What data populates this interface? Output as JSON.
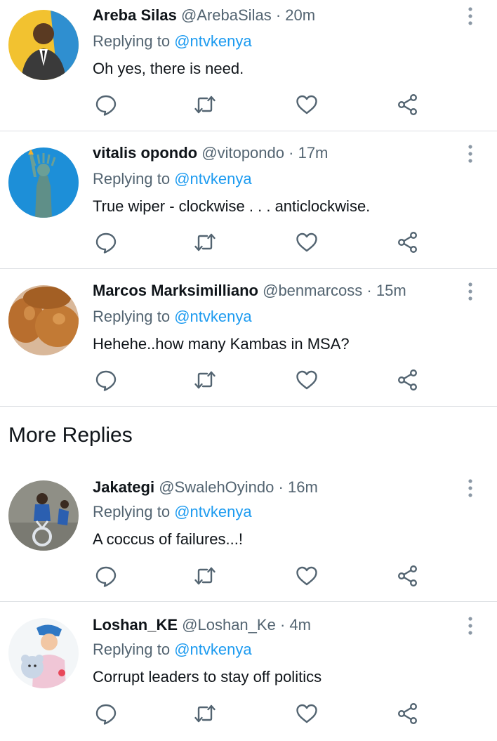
{
  "section": {
    "more_replies_label": "More Replies"
  },
  "tweets": [
    {
      "name": "Areba Silas",
      "handle": "@ArebaSilas",
      "separator": "·",
      "time": "20m",
      "replying_prefix": "Replying to",
      "replying_to": "@ntvkenya",
      "text": "Oh yes, there is need."
    },
    {
      "name": "vitalis opondo",
      "handle": "@vitopondo",
      "separator": "·",
      "time": "17m",
      "replying_prefix": "Replying to",
      "replying_to": "@ntvkenya",
      "text": "True wiper - clockwise . . . anticlockwise."
    },
    {
      "name": "Marcos Marksimilliano",
      "handle": "@benmarcoss",
      "separator": "·",
      "time": "15m",
      "replying_prefix": "Replying to",
      "replying_to": "@ntvkenya",
      "text": "Hehehe..how many Kambas in MSA?"
    },
    {
      "name": "Jakategi",
      "handle": "@SwalehOyindo",
      "separator": "·",
      "time": "16m",
      "replying_prefix": "Replying to",
      "replying_to": "@ntvkenya",
      "text": "A coccus of failures...!"
    },
    {
      "name": "Loshan_KE",
      "handle": "@Loshan_Ke",
      "separator": "·",
      "time": "4m",
      "replying_prefix": "Replying to",
      "replying_to": "@ntvkenya",
      "text": "Corrupt leaders to stay off politics"
    }
  ],
  "icons": {
    "reply": "reply-icon",
    "retweet": "retweet-icon",
    "like": "like-icon",
    "share": "share-icon",
    "more": "more-options-icon"
  },
  "colors": {
    "mention": "#1d9bf0",
    "secondary_text": "#536471",
    "primary_text": "#0f1419",
    "icon": "#536471",
    "divider": "#dcdfe3"
  }
}
